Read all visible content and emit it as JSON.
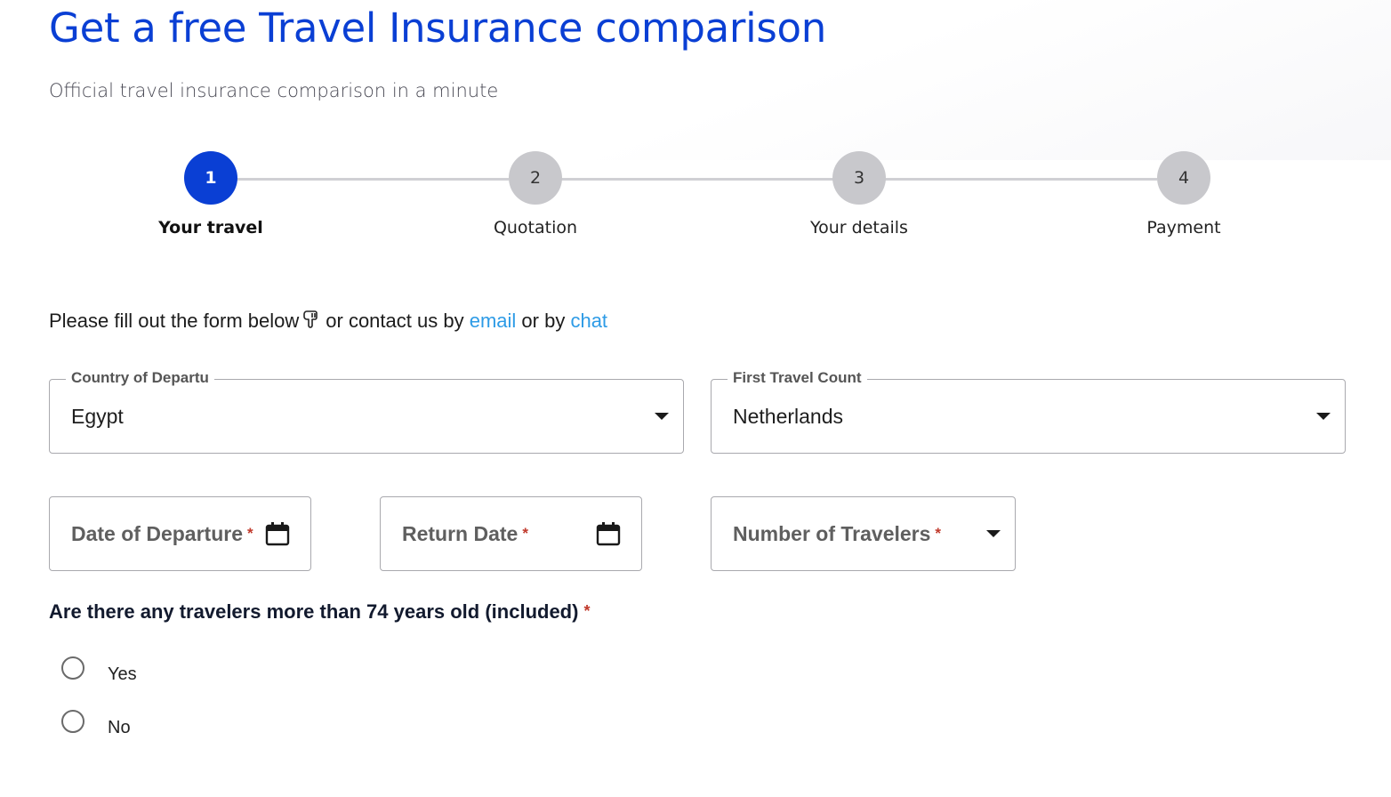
{
  "header": {
    "title": "Get a free Travel Insurance comparison",
    "subtitle": "Official travel insurance comparison in a minute"
  },
  "stepper": {
    "active_step": 1,
    "steps": [
      {
        "number": "1",
        "label": "Your travel"
      },
      {
        "number": "2",
        "label": "Quotation"
      },
      {
        "number": "3",
        "label": "Your details"
      },
      {
        "number": "4",
        "label": "Payment"
      }
    ]
  },
  "intro": {
    "text_before": "Please fill out the form below",
    "icon": "pointing-down-hand-icon",
    "text_middle": "or contact us by",
    "email_link": "email",
    "text_or": "or by",
    "chat_link": "chat"
  },
  "form": {
    "country_of_departure": {
      "label": "Country of Departu",
      "value": "Egypt"
    },
    "first_travel_country": {
      "label": "First Travel Count",
      "value": "Netherlands"
    },
    "date_of_departure": {
      "placeholder": "Date of Departure",
      "required_mark": "*",
      "icon": "calendar-icon"
    },
    "return_date": {
      "placeholder": "Return Date",
      "required_mark": "*",
      "icon": "calendar-icon"
    },
    "number_of_travelers": {
      "placeholder": "Number of Travelers",
      "required_mark": "*"
    },
    "age_question": {
      "text": "Are there any travelers more than 74 years old (included)",
      "required_mark": "*",
      "options": [
        {
          "label": "Yes",
          "selected": false
        },
        {
          "label": "No",
          "selected": false
        }
      ]
    }
  },
  "colors": {
    "brand_blue": "#0a3fd4",
    "link_blue": "#2d9be6",
    "required_red": "#c0392b",
    "inactive_step": "#c8c8cc"
  }
}
